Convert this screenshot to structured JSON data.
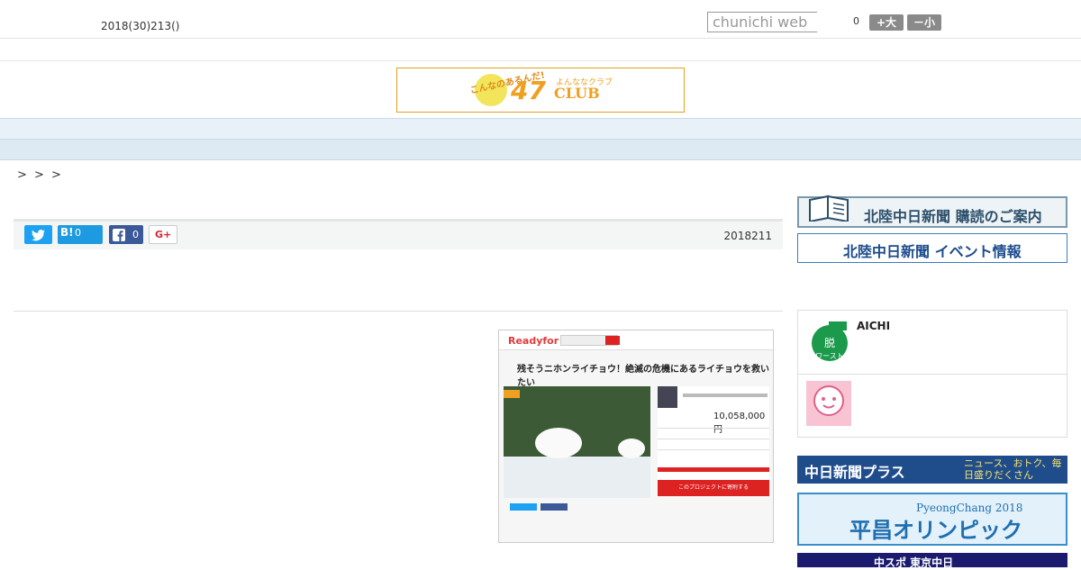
{
  "header": {
    "date": "2018(30)213()",
    "search_placeholder": "chunichi web",
    "font_size_count": "0",
    "font_larger_label": "+大",
    "font_smaller_label": "－小"
  },
  "logo": {
    "tagline": "こんなのあるんだ!",
    "name": "47",
    "sub": "よんななクラブ",
    "club": "CLUB"
  },
  "nav": {
    "items": [
      "",
      "",
      "",
      "",
      "",
      "",
      "",
      "",
      ""
    ]
  },
  "breadcrumb": "> > >",
  "share": {
    "hatena_label": "B!",
    "hatena_count": "0",
    "facebook_count": "0",
    "gplus_label": "G+",
    "publish_date": "2018211"
  },
  "photo": {
    "site_logo": "Readyfor",
    "headline": "残そうニホンライチョウ！絶滅の危機にあるライチョウを救いたい",
    "funded_amount": "10,058,000円",
    "cta": "このプロジェクトに寄附する"
  },
  "sidebar": {
    "subscribe_banner": "北陸中日新聞 購読のご案内",
    "events_banner": "北陸中日新聞 イベント情報",
    "aichi_label": "AICHI",
    "plus_banner": "中日新聞プラス",
    "plus_tagline": "ニュース、おトク、毎日盛りだくさん",
    "olympic_banner": "平昌オリンピック",
    "olympic_sub": "PyeongChang 2018",
    "chuspo_banner": "中スポ 東京中日"
  },
  "colors": {
    "nav_bg": "#e8f1f8",
    "twitter": "#1da1f2",
    "hatena": "#1e9be0",
    "facebook": "#3b5998",
    "logo_accent": "#f0a020"
  },
  "icons": {
    "twitter": "twitter-icon",
    "facebook": "facebook-icon",
    "hatena": "hatena-icon",
    "gplus": "gplus-icon"
  }
}
